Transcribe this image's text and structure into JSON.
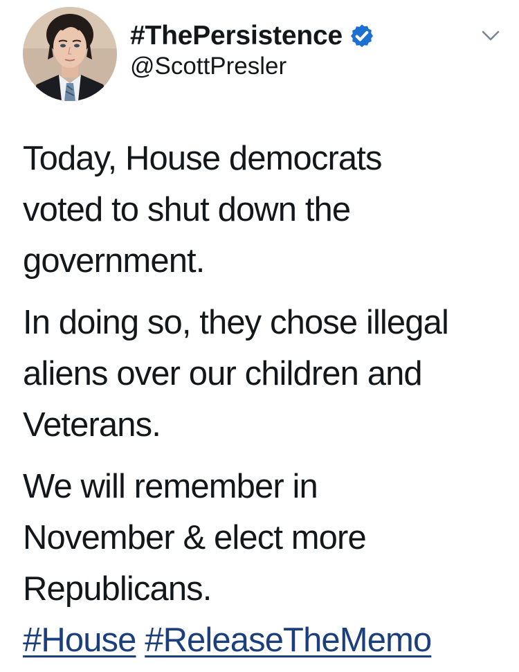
{
  "author": {
    "display_name": "#ThePersistence",
    "handle": "@ScottPresler",
    "verified": true,
    "avatar_icon": "profile-photo",
    "verified_icon": "verified-badge-icon",
    "menu_icon": "chevron-down-icon"
  },
  "tweet": {
    "paragraphs": [
      {
        "lines": [
          "Today, House democrats",
          "voted to shut down the",
          "government."
        ]
      },
      {
        "lines": [
          "In doing so, they chose illegal",
          "aliens over our children and",
          "Veterans."
        ]
      },
      {
        "lines": [
          "We will remember in",
          "November & elect more",
          "Republicans."
        ]
      }
    ],
    "hashtags": [
      "#House",
      "#ReleaseTheMemo"
    ]
  },
  "colors": {
    "text": "#14171a",
    "link": "#1b3f7d",
    "verified_badge": "#1d6fd0",
    "background": "#ffffff"
  }
}
